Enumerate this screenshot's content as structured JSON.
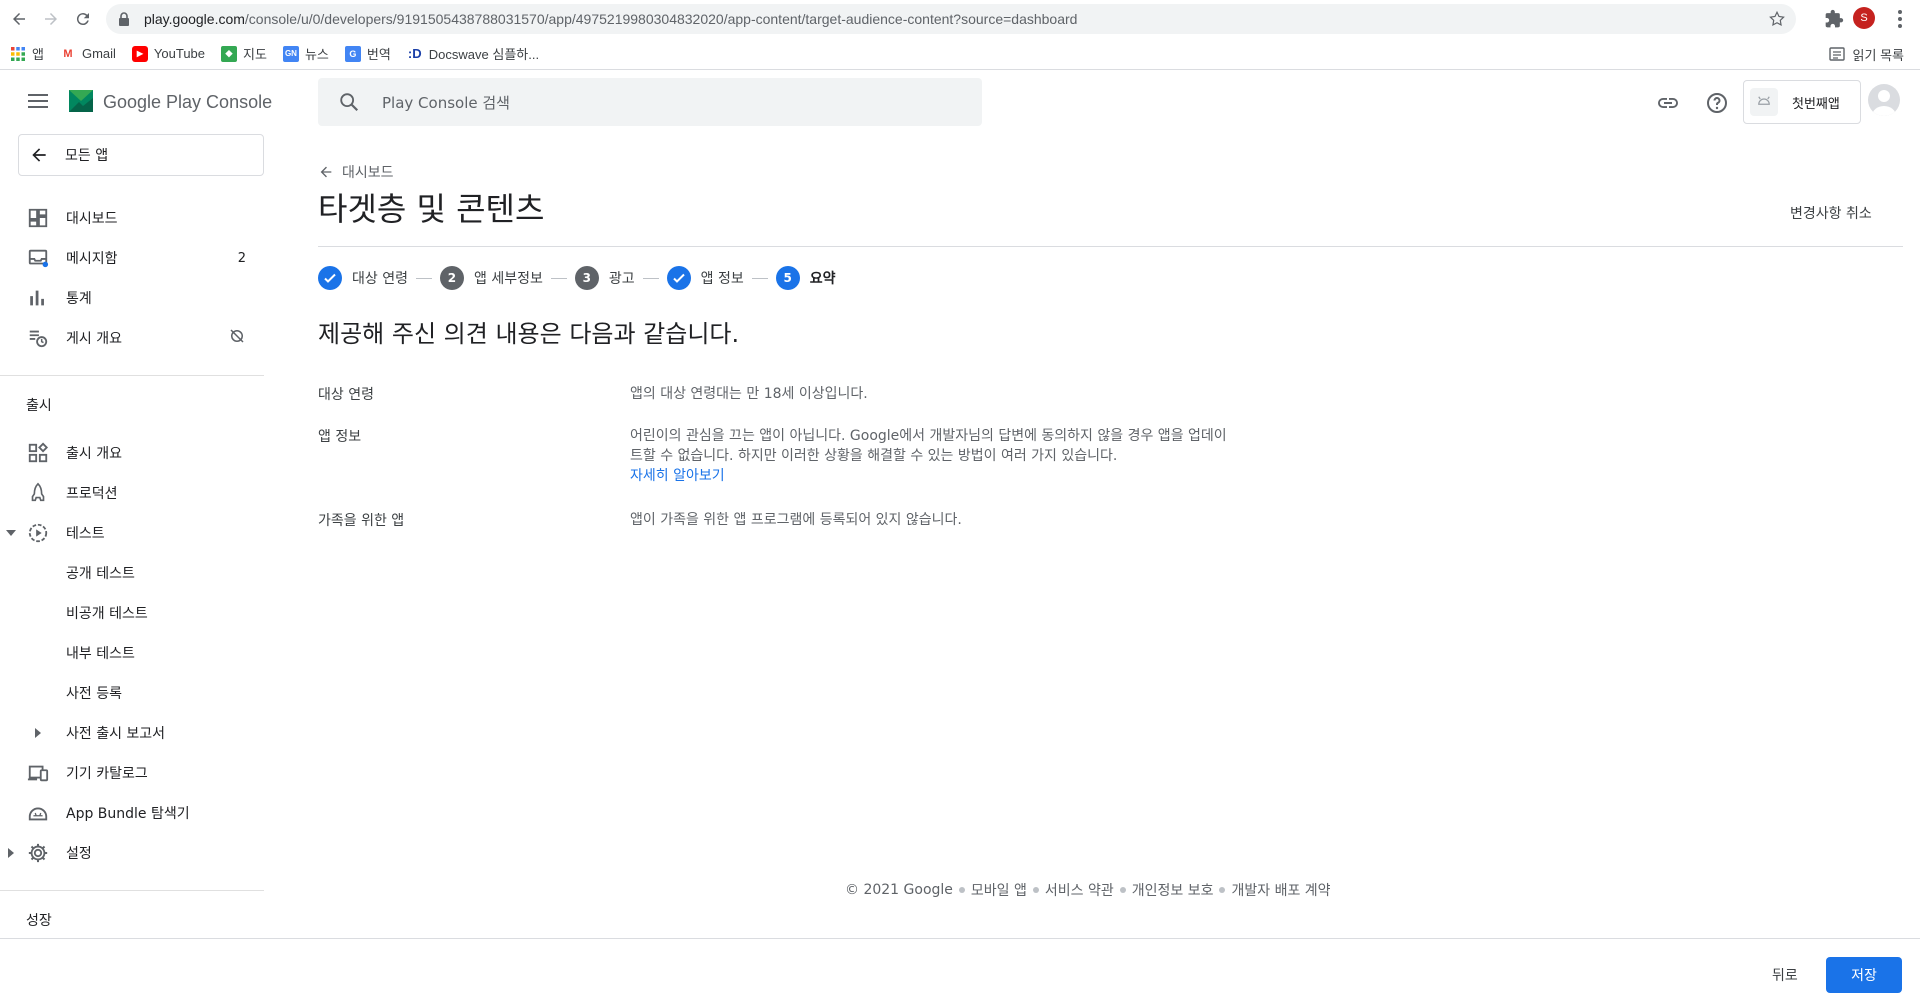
{
  "browser": {
    "url_host": "play.google.com",
    "url_path": "/console/u/0/developers/9191505438788031570/app/4975219980304832020/app-content/target-audience-content?source=dashboard",
    "profile_initial": "S",
    "bookmarks": [
      {
        "icon": "apps-grid-icon",
        "label": "앱"
      },
      {
        "icon": "gmail-icon",
        "label": "Gmail"
      },
      {
        "icon": "youtube-icon",
        "label": "YouTube"
      },
      {
        "icon": "maps-icon",
        "label": "지도"
      },
      {
        "icon": "news-icon",
        "label": "뉴스"
      },
      {
        "icon": "translate-icon",
        "label": "번역"
      },
      {
        "icon": "docswave-icon",
        "label": "Docswave 심플하..."
      }
    ],
    "reading_list": "읽기 목록"
  },
  "console": {
    "product_name": "Google Play Console",
    "search_placeholder": "Play Console 검색",
    "app_name": "첫번째앱",
    "all_apps": "모든 앱",
    "sidebar": {
      "items": [
        {
          "icon": "dashboard-icon",
          "label": "대시보드"
        },
        {
          "icon": "inbox-icon",
          "label": "메시지함",
          "badge": "2"
        },
        {
          "icon": "stats-icon",
          "label": "통계"
        },
        {
          "icon": "publishing-overview-icon",
          "label": "게시 개요"
        }
      ],
      "release_section": "출시",
      "release_items": [
        {
          "icon": "release-overview-icon",
          "label": "출시 개요"
        },
        {
          "icon": "production-icon",
          "label": "프로덕션"
        },
        {
          "icon": "testing-icon",
          "label": "테스트"
        }
      ],
      "testing_sub": [
        "공개 테스트",
        "비공개 테스트",
        "내부 테스트",
        "사전 등록"
      ],
      "pre_launch": "사전 출시 보고서",
      "device_catalog": "기기 카탈로그",
      "bundle_explorer": "App Bundle 탐색기",
      "settings": "설정",
      "growth_section": "성장"
    }
  },
  "page": {
    "breadcrumb": "대시보드",
    "title": "타겟층 및 콘텐츠",
    "discard": "변경사항 취소",
    "steps": [
      {
        "state": "done",
        "label": "대상 연령"
      },
      {
        "state": "num",
        "number": "2",
        "label": "앱 세부정보"
      },
      {
        "state": "num",
        "number": "3",
        "label": "광고"
      },
      {
        "state": "done",
        "label": "앱 정보"
      },
      {
        "state": "active",
        "number": "5",
        "label": "요약"
      }
    ],
    "summary_title": "제공해 주신 의견 내용은 다음과 같습니다.",
    "rows": [
      {
        "key": "대상 연령",
        "value": "앱의 대상 연령대는 만 18세 이상입니다."
      },
      {
        "key": "앱 정보",
        "value": "어린이의 관심을 끄는 앱이 아닙니다. Google에서 개발자님의 답변에 동의하지 않을 경우 앱을 업데이트할 수 없습니다. 하지만 이러한 상황을 해결할 수 있는 방법이 여러 가지 있습니다.",
        "link": "자세히 알아보기"
      },
      {
        "key": "가족을 위한 앱",
        "value": "앱이 가족을 위한 앱 프로그램에 등록되어 있지 않습니다."
      }
    ],
    "footer": [
      "© 2021 Google",
      "모바일 앱",
      "서비스 약관",
      "개인정보 보호",
      "개발자 배포 계약"
    ],
    "back_button": "뒤로",
    "save_button": "저장"
  },
  "colors": {
    "accent": "#1a73e8",
    "text": "#202124",
    "muted": "#5f6368"
  }
}
